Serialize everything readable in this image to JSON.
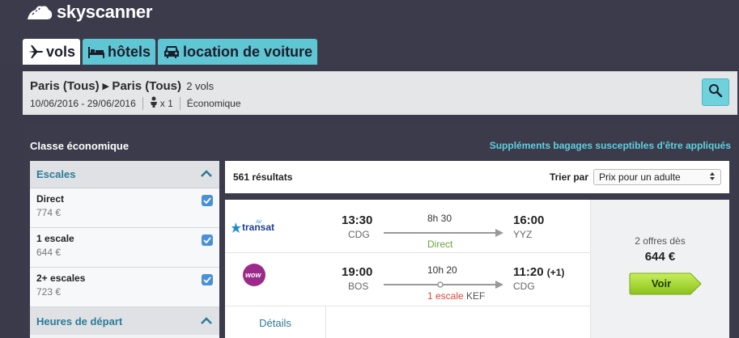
{
  "brand": {
    "name": "skyscanner"
  },
  "tabs": [
    {
      "label": "vols",
      "icon": "plane-icon",
      "active": true
    },
    {
      "label": "hôtels",
      "icon": "bed-icon",
      "active": false
    },
    {
      "label": "location de voiture",
      "icon": "car-icon",
      "active": false
    }
  ],
  "search": {
    "route": "Paris (Tous) ▸ Paris (Tous)",
    "flights_count": "2 vols",
    "dates": "10/06/2016 - 29/06/2016",
    "passengers": "x 1",
    "cabin": "Économique"
  },
  "panel": {
    "class_title": "Classe économique",
    "baggage_note": "Suppléments bagages susceptibles d'être appliqués"
  },
  "filters": {
    "stops_title": "Escales",
    "stops": [
      {
        "label": "Direct",
        "price": "774 €",
        "checked": true
      },
      {
        "label": "1 escale",
        "price": "644 €",
        "checked": true
      },
      {
        "label": "2+ escales",
        "price": "723 €",
        "checked": true
      }
    ],
    "departure_title": "Heures de départ"
  },
  "results": {
    "count": "561 résultats",
    "sort_label": "Trier par",
    "sort_value": "Prix pour un adulte"
  },
  "card": {
    "outbound": {
      "airline_logo": "transat",
      "airline_small": "Air",
      "dep_time": "13:30",
      "dep_airport": "CDG",
      "duration": "8h 30",
      "stops": "Direct",
      "arr_time": "16:00",
      "arr_airport": "YYZ"
    },
    "return": {
      "airline_logo": "wow",
      "dep_time": "19:00",
      "dep_airport": "BOS",
      "duration": "10h 20",
      "stops": "1 escale",
      "via": "KEF",
      "arr_time": "11:20",
      "day_offset": "(+1)",
      "arr_airport": "CDG"
    },
    "offers": "2 offres dès",
    "price": "644 €",
    "cta": "Voir",
    "details": "Détails"
  },
  "colors": {
    "header": "#3c3b4c",
    "accent": "#5fc6d4",
    "cta": "#9bd62a",
    "direct": "#6ba33a",
    "stop": "#e0453a"
  }
}
